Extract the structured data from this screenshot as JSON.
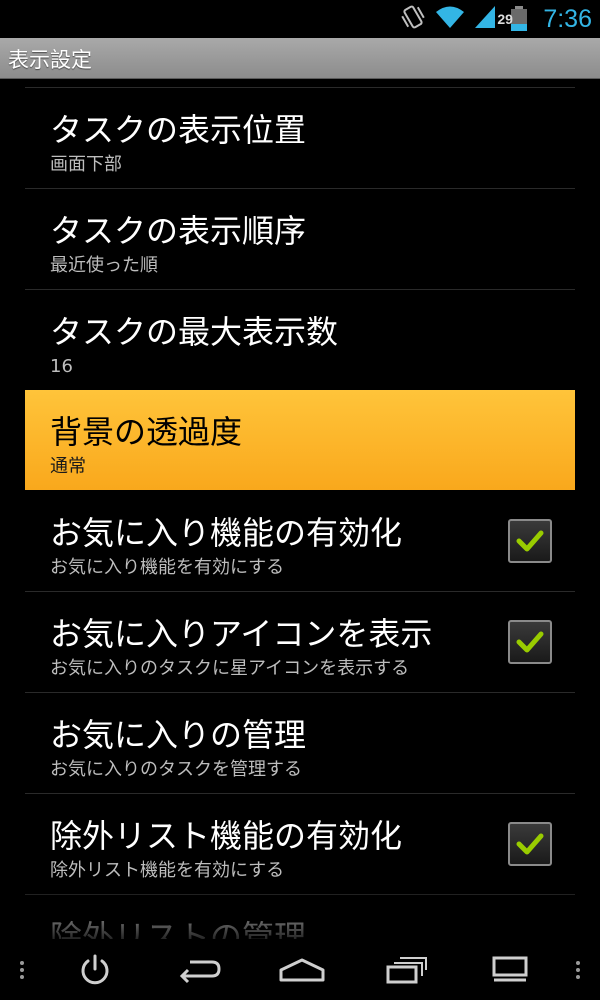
{
  "status_bar": {
    "time": "7:36",
    "battery_level": "29",
    "icons": [
      "vibrate-icon",
      "wifi-icon",
      "signal-icon",
      "battery-icon"
    ]
  },
  "title_bar": {
    "title": "表示設定"
  },
  "preferences": [
    {
      "title": "タスクの表示位置",
      "summary": "画面下部",
      "checkbox": null
    },
    {
      "title": "タスクの表示順序",
      "summary": "最近使った順",
      "checkbox": null
    },
    {
      "title": "タスクの最大表示数",
      "summary": "16",
      "checkbox": null
    },
    {
      "title": "背景の透過度",
      "summary": "通常",
      "checkbox": null,
      "highlighted": true
    },
    {
      "title": "お気に入り機能の有効化",
      "summary": "お気に入り機能を有効にする",
      "checkbox": true
    },
    {
      "title": "お気に入りアイコンを表示",
      "summary": "お気に入りのタスクに星アイコンを表示する",
      "checkbox": true
    },
    {
      "title": "お気に入りの管理",
      "summary": "お気に入りのタスクを管理する",
      "checkbox": null
    },
    {
      "title": "除外リスト機能の有効化",
      "summary": "除外リスト機能を有効にする",
      "checkbox": true
    },
    {
      "title": "除外リストの管理",
      "summary": "",
      "checkbox": null
    }
  ],
  "colors": {
    "accent": "#33b5e5",
    "highlight": "#fbb12a",
    "check": "#99cc00",
    "title_bar": "#9a9a9a"
  },
  "nav_bar": {
    "icons": [
      "menu-dots-icon",
      "power-icon",
      "back-icon",
      "home-icon",
      "recent-apps-icon",
      "taskbar-icon",
      "menu-dots-icon"
    ]
  }
}
